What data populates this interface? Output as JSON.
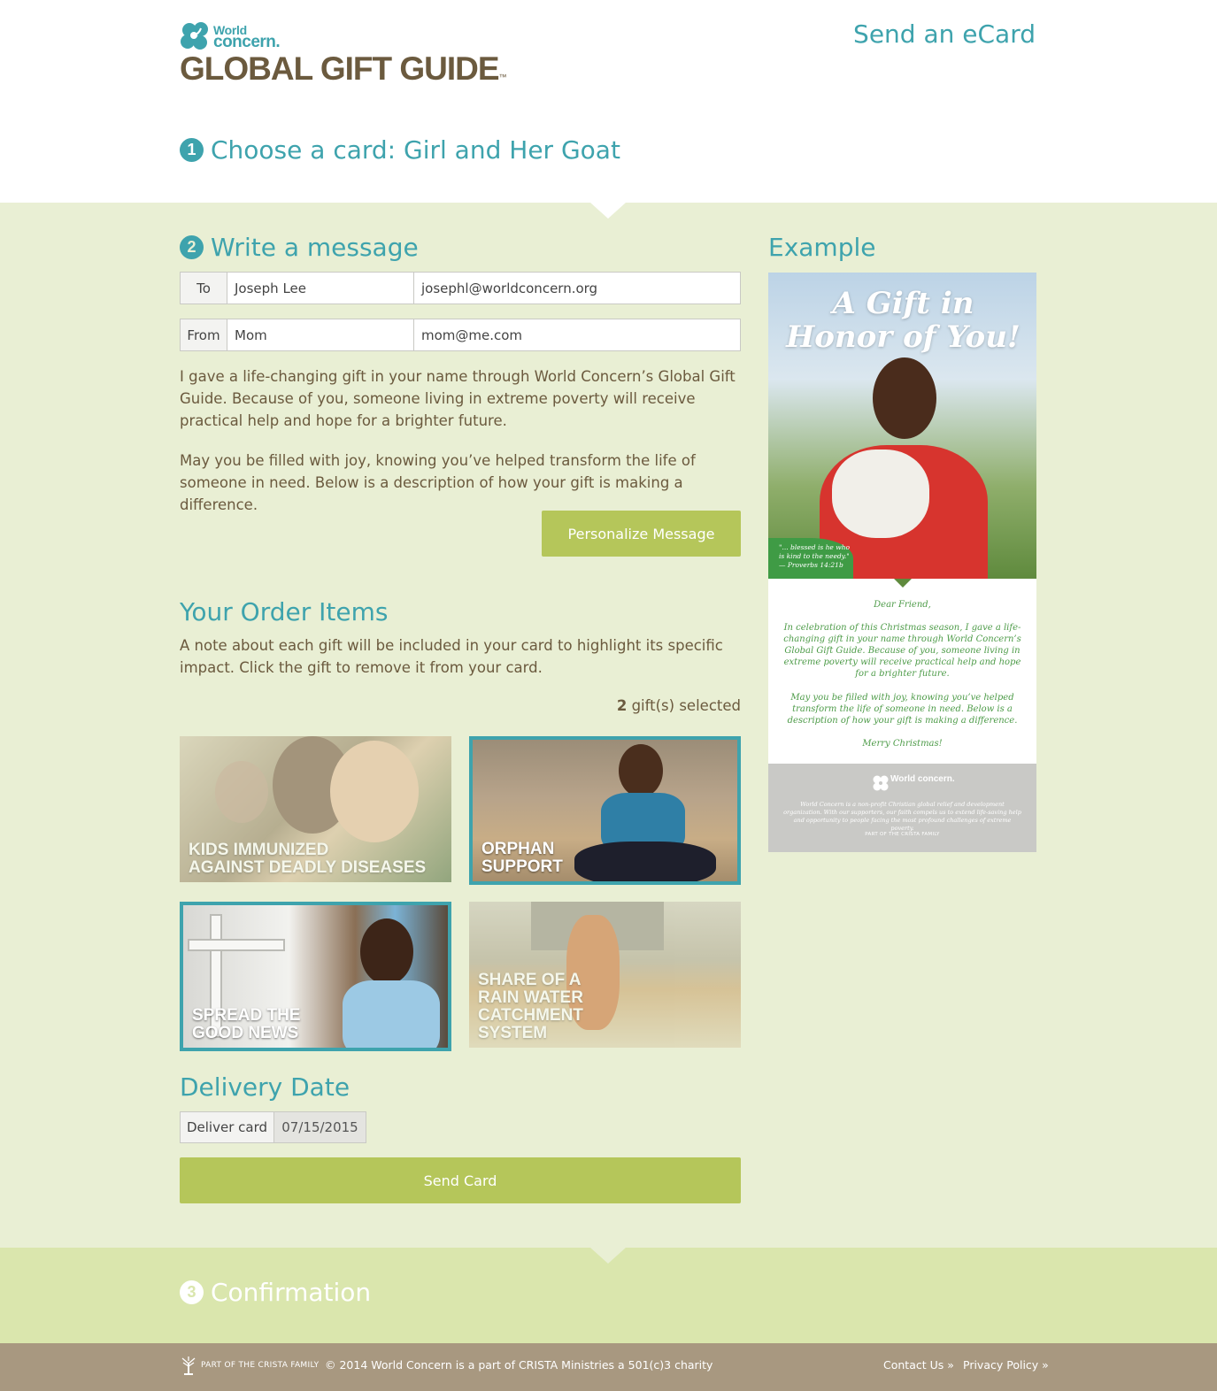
{
  "header": {
    "logo_world": "World",
    "logo_concern": "concern.",
    "logo_title": "GLOBAL GIFT GUIDE",
    "logo_tm": "™",
    "send_ecard": "Send an eCard"
  },
  "steps": {
    "step1_number": "1",
    "step1_title": "Choose a card: Girl and Her Goat",
    "step2_number": "2",
    "step2_title": "Write a message",
    "step3_number": "3",
    "step3_title": "Confirmation"
  },
  "form": {
    "to_label": "To",
    "to_name": "Joseph Lee",
    "to_email": "josephl@worldconcern.org",
    "from_label": "From",
    "from_name": "Mom",
    "from_email": "mom@me.com"
  },
  "message": {
    "paragraph1": "I gave a life-changing gift in your name through World Concern’s Global Gift Guide. Because of you, someone living in extreme poverty will receive practical help and hope for a brighter future.",
    "paragraph2": "May you be filled with joy, knowing you’ve helped transform the life of someone in need. Below is a description of how your gift is making a difference.",
    "personalize_button": "Personalize Message"
  },
  "order": {
    "heading": "Your Order Items",
    "note": "A note about each gift will be included in your card to highlight its specific impact. Click the gift to remove it from your card.",
    "count": "2",
    "count_suffix": " gift(s) selected",
    "items": [
      {
        "label": "Kids immunized\nagainst deadly diseases",
        "selected": false
      },
      {
        "label": "Orphan\nsupport",
        "selected": true
      },
      {
        "label": "Spread the\ngood news",
        "selected": true
      },
      {
        "label": "Share of a\nrain water\ncatchment\nsystem",
        "selected": false
      }
    ]
  },
  "delivery": {
    "heading": "Delivery Date",
    "label": "Deliver card",
    "date": "07/15/2015",
    "send_button": "Send Card"
  },
  "example": {
    "heading": "Example",
    "headline": "A Gift in Honor of You!",
    "verse": "\"... blessed is he who is kind to the needy.\" — Proverbs 14:21b",
    "greeting": "Dear Friend,",
    "body1": "In celebration of this Christmas season, I gave a life-changing gift in your name through World Concern’s Global Gift Guide. Because of you, someone living in extreme poverty will receive practical help and hope for a brighter future.",
    "body2": "May you be filled with joy, knowing you’ve helped transform the life of someone in need. Below is a description of how your gift is making a difference.",
    "closing": "Merry Christmas!",
    "footer_logo": "World concern.",
    "footer_text": "World Concern is a non-profit Christian global relief and development organization. With our supporters, our faith compels us to extend life-saving help and opportunity to people facing the most profound challenges of extreme poverty.",
    "footer_crista": "PART OF THE CRISTA FAMILY"
  },
  "footer": {
    "crista": "PART OF THE CRISTA FAMILY",
    "copyright": "© 2014 World Concern is a part of CRISTA Ministries a 501(c)3 charity",
    "contact": "Contact Us »",
    "privacy": "Privacy Policy »"
  },
  "colors": {
    "teal": "#3ea3ad",
    "brown": "#6b5a3e",
    "green_button": "#b5c65a",
    "section_bg": "#e9efd4",
    "confirm_bg": "#dae6ad",
    "footer_bg": "#a89880"
  },
  "icons": [
    "world-concern-flower-icon",
    "crista-tree-icon"
  ]
}
